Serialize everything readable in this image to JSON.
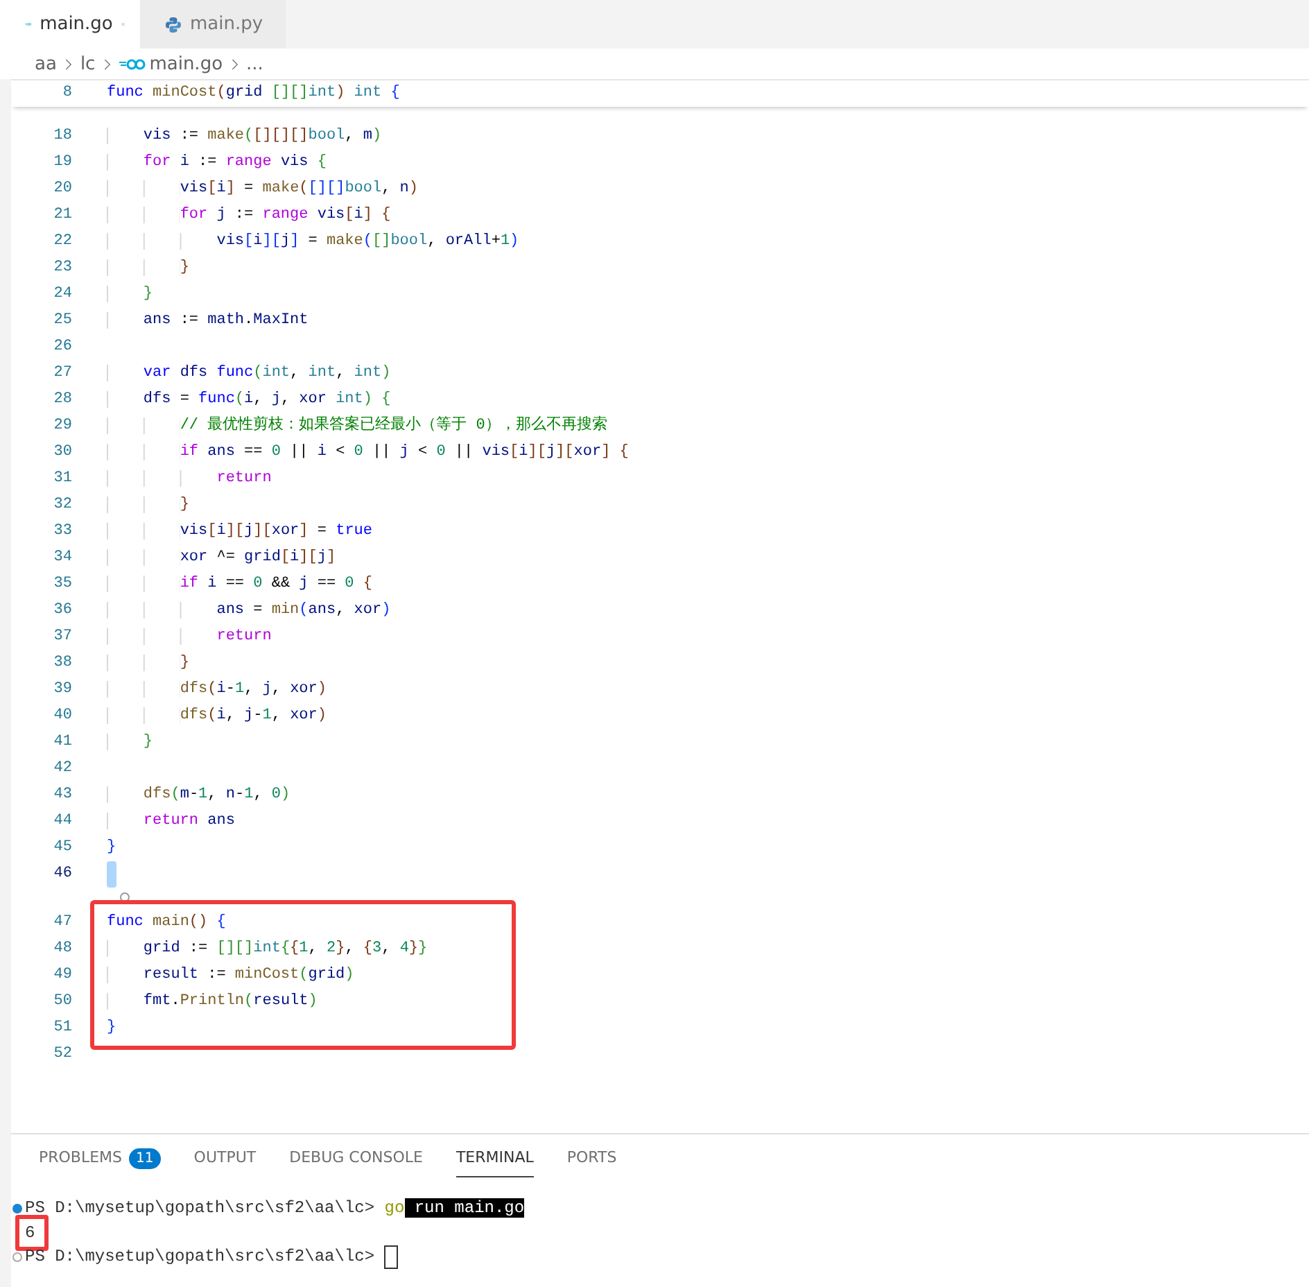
{
  "tabs": [
    {
      "label": "main.go",
      "kind": "go",
      "selected": true
    },
    {
      "label": "main.py",
      "kind": "python",
      "selected": false
    }
  ],
  "breadcrumb": [
    {
      "label": "aa"
    },
    {
      "label": "lc"
    },
    {
      "label": "main.go",
      "kind": "go"
    },
    {
      "label": "..."
    }
  ],
  "sticky_line": {
    "n": "8",
    "tokens": [
      {
        "kind": "kw",
        "text": "func "
      },
      {
        "kind": "fn",
        "text": "minCost"
      },
      {
        "kind": "b3",
        "text": "("
      },
      {
        "kind": "var",
        "text": "grid "
      },
      {
        "kind": "b2",
        "text": "[][]"
      },
      {
        "kind": "type",
        "text": "int"
      },
      {
        "kind": "b3",
        "text": ") "
      },
      {
        "kind": "type",
        "text": "int "
      },
      {
        "kind": "b1",
        "text": "{"
      }
    ]
  },
  "blocks": [
    {
      "framed": false,
      "lines": [
        {
          "n": "18",
          "tokens": [
            {
              "kind": "var",
              "text": "    vis"
            },
            {
              "kind": "op",
              "text": " := "
            },
            {
              "kind": "fn",
              "text": "make"
            },
            {
              "kind": "b2",
              "text": "("
            },
            {
              "kind": "b3",
              "text": "[][][]"
            },
            {
              "kind": "type",
              "text": "bool"
            },
            {
              "kind": "op",
              "text": ", "
            },
            {
              "kind": "var",
              "text": "m"
            },
            {
              "kind": "b2",
              "text": ")"
            }
          ]
        },
        {
          "n": "19",
          "tokens": [
            {
              "kind": "ctl",
              "text": "    for "
            },
            {
              "kind": "var",
              "text": "i"
            },
            {
              "kind": "op",
              "text": " := "
            },
            {
              "kind": "ctl",
              "text": "range "
            },
            {
              "kind": "var",
              "text": "vis "
            },
            {
              "kind": "b2",
              "text": "{"
            }
          ]
        },
        {
          "n": "20",
          "tokens": [
            {
              "kind": "var",
              "text": "        vis"
            },
            {
              "kind": "b3",
              "text": "["
            },
            {
              "kind": "var",
              "text": "i"
            },
            {
              "kind": "b3",
              "text": "]"
            },
            {
              "kind": "op",
              "text": " = "
            },
            {
              "kind": "fn",
              "text": "make"
            },
            {
              "kind": "b3",
              "text": "("
            },
            {
              "kind": "b1",
              "text": "[][]"
            },
            {
              "kind": "type",
              "text": "bool"
            },
            {
              "kind": "op",
              "text": ", "
            },
            {
              "kind": "var",
              "text": "n"
            },
            {
              "kind": "b3",
              "text": ")"
            }
          ]
        },
        {
          "n": "21",
          "tokens": [
            {
              "kind": "ctl",
              "text": "        for "
            },
            {
              "kind": "var",
              "text": "j"
            },
            {
              "kind": "op",
              "text": " := "
            },
            {
              "kind": "ctl",
              "text": "range "
            },
            {
              "kind": "var",
              "text": "vis"
            },
            {
              "kind": "b3",
              "text": "["
            },
            {
              "kind": "var",
              "text": "i"
            },
            {
              "kind": "b3",
              "text": "] {"
            }
          ]
        },
        {
          "n": "22",
          "tokens": [
            {
              "kind": "var",
              "text": "            vis"
            },
            {
              "kind": "b1",
              "text": "["
            },
            {
              "kind": "var",
              "text": "i"
            },
            {
              "kind": "b1",
              "text": "]["
            },
            {
              "kind": "var",
              "text": "j"
            },
            {
              "kind": "b1",
              "text": "]"
            },
            {
              "kind": "op",
              "text": " = "
            },
            {
              "kind": "fn",
              "text": "make"
            },
            {
              "kind": "b1",
              "text": "("
            },
            {
              "kind": "b2",
              "text": "[]"
            },
            {
              "kind": "type",
              "text": "bool"
            },
            {
              "kind": "op",
              "text": ", "
            },
            {
              "kind": "var",
              "text": "orAll"
            },
            {
              "kind": "op",
              "text": "+"
            },
            {
              "kind": "num",
              "text": "1"
            },
            {
              "kind": "b1",
              "text": ")"
            }
          ]
        },
        {
          "n": "23",
          "tokens": [
            {
              "kind": "b3",
              "text": "        }"
            }
          ]
        },
        {
          "n": "24",
          "tokens": [
            {
              "kind": "b2",
              "text": "    }"
            }
          ]
        },
        {
          "n": "25",
          "tokens": [
            {
              "kind": "var",
              "text": "    ans"
            },
            {
              "kind": "op",
              "text": " := "
            },
            {
              "kind": "var",
              "text": "math"
            },
            {
              "kind": "op",
              "text": "."
            },
            {
              "kind": "var",
              "text": "MaxInt"
            }
          ]
        },
        {
          "n": "26"
        },
        {
          "n": "27",
          "tokens": [
            {
              "kind": "kw",
              "text": "    var "
            },
            {
              "kind": "var",
              "text": "dfs "
            },
            {
              "kind": "kw",
              "text": "func"
            },
            {
              "kind": "b2",
              "text": "("
            },
            {
              "kind": "type",
              "text": "int"
            },
            {
              "kind": "op",
              "text": ", "
            },
            {
              "kind": "type",
              "text": "int"
            },
            {
              "kind": "op",
              "text": ", "
            },
            {
              "kind": "type",
              "text": "int"
            },
            {
              "kind": "b2",
              "text": ")"
            }
          ]
        },
        {
          "n": "28",
          "tokens": [
            {
              "kind": "var",
              "text": "    dfs"
            },
            {
              "kind": "op",
              "text": " = "
            },
            {
              "kind": "kw",
              "text": "func"
            },
            {
              "kind": "b2",
              "text": "("
            },
            {
              "kind": "var",
              "text": "i"
            },
            {
              "kind": "op",
              "text": ", "
            },
            {
              "kind": "var",
              "text": "j"
            },
            {
              "kind": "op",
              "text": ", "
            },
            {
              "kind": "var",
              "text": "xor "
            },
            {
              "kind": "type",
              "text": "int"
            },
            {
              "kind": "b2",
              "text": ") {"
            }
          ]
        },
        {
          "n": "29",
          "tokens": [
            {
              "kind": "com",
              "text": "        // 最优性剪枝：如果答案已经最小（等于 0），那么不再搜索"
            }
          ]
        },
        {
          "n": "30",
          "tokens": [
            {
              "kind": "ctl",
              "text": "        if "
            },
            {
              "kind": "var",
              "text": "ans"
            },
            {
              "kind": "op",
              "text": " == "
            },
            {
              "kind": "num",
              "text": "0"
            },
            {
              "kind": "op",
              "text": " || "
            },
            {
              "kind": "var",
              "text": "i"
            },
            {
              "kind": "op",
              "text": " < "
            },
            {
              "kind": "num",
              "text": "0"
            },
            {
              "kind": "op",
              "text": " || "
            },
            {
              "kind": "var",
              "text": "j"
            },
            {
              "kind": "op",
              "text": " < "
            },
            {
              "kind": "num",
              "text": "0"
            },
            {
              "kind": "op",
              "text": " || "
            },
            {
              "kind": "var",
              "text": "vis"
            },
            {
              "kind": "b3",
              "text": "["
            },
            {
              "kind": "var",
              "text": "i"
            },
            {
              "kind": "b3",
              "text": "]["
            },
            {
              "kind": "var",
              "text": "j"
            },
            {
              "kind": "b3",
              "text": "]["
            },
            {
              "kind": "var",
              "text": "xor"
            },
            {
              "kind": "b3",
              "text": "] {"
            }
          ]
        },
        {
          "n": "31",
          "tokens": [
            {
              "kind": "ctl",
              "text": "            return"
            }
          ]
        },
        {
          "n": "32",
          "tokens": [
            {
              "kind": "b3",
              "text": "        }"
            }
          ]
        },
        {
          "n": "33",
          "tokens": [
            {
              "kind": "var",
              "text": "        vis"
            },
            {
              "kind": "b3",
              "text": "["
            },
            {
              "kind": "var",
              "text": "i"
            },
            {
              "kind": "b3",
              "text": "]["
            },
            {
              "kind": "var",
              "text": "j"
            },
            {
              "kind": "b3",
              "text": "]["
            },
            {
              "kind": "var",
              "text": "xor"
            },
            {
              "kind": "b3",
              "text": "]"
            },
            {
              "kind": "op",
              "text": " = "
            },
            {
              "kind": "kw",
              "text": "true"
            }
          ]
        },
        {
          "n": "34",
          "tokens": [
            {
              "kind": "var",
              "text": "        xor"
            },
            {
              "kind": "op",
              "text": " ^= "
            },
            {
              "kind": "var",
              "text": "grid"
            },
            {
              "kind": "b3",
              "text": "["
            },
            {
              "kind": "var",
              "text": "i"
            },
            {
              "kind": "b3",
              "text": "]["
            },
            {
              "kind": "var",
              "text": "j"
            },
            {
              "kind": "b3",
              "text": "]"
            }
          ]
        },
        {
          "n": "35",
          "tokens": [
            {
              "kind": "ctl",
              "text": "        if "
            },
            {
              "kind": "var",
              "text": "i"
            },
            {
              "kind": "op",
              "text": " == "
            },
            {
              "kind": "num",
              "text": "0"
            },
            {
              "kind": "op",
              "text": " && "
            },
            {
              "kind": "var",
              "text": "j"
            },
            {
              "kind": "op",
              "text": " == "
            },
            {
              "kind": "num",
              "text": "0"
            },
            {
              "kind": "b3",
              "text": " {"
            }
          ]
        },
        {
          "n": "36",
          "tokens": [
            {
              "kind": "var",
              "text": "            ans"
            },
            {
              "kind": "op",
              "text": " = "
            },
            {
              "kind": "fn",
              "text": "min"
            },
            {
              "kind": "b1",
              "text": "("
            },
            {
              "kind": "var",
              "text": "ans"
            },
            {
              "kind": "op",
              "text": ", "
            },
            {
              "kind": "var",
              "text": "xor"
            },
            {
              "kind": "b1",
              "text": ")"
            }
          ]
        },
        {
          "n": "37",
          "tokens": [
            {
              "kind": "ctl",
              "text": "            return"
            }
          ]
        },
        {
          "n": "38",
          "tokens": [
            {
              "kind": "b3",
              "text": "        }"
            }
          ]
        },
        {
          "n": "39",
          "tokens": [
            {
              "kind": "fn",
              "text": "        dfs"
            },
            {
              "kind": "b3",
              "text": "("
            },
            {
              "kind": "var",
              "text": "i"
            },
            {
              "kind": "op",
              "text": "-"
            },
            {
              "kind": "num",
              "text": "1"
            },
            {
              "kind": "op",
              "text": ", "
            },
            {
              "kind": "var",
              "text": "j"
            },
            {
              "kind": "op",
              "text": ", "
            },
            {
              "kind": "var",
              "text": "xor"
            },
            {
              "kind": "b3",
              "text": ")"
            }
          ]
        },
        {
          "n": "40",
          "tokens": [
            {
              "kind": "fn",
              "text": "        dfs"
            },
            {
              "kind": "b3",
              "text": "("
            },
            {
              "kind": "var",
              "text": "i"
            },
            {
              "kind": "op",
              "text": ", "
            },
            {
              "kind": "var",
              "text": "j"
            },
            {
              "kind": "op",
              "text": "-"
            },
            {
              "kind": "num",
              "text": "1"
            },
            {
              "kind": "op",
              "text": ", "
            },
            {
              "kind": "var",
              "text": "xor"
            },
            {
              "kind": "b3",
              "text": ")"
            }
          ]
        },
        {
          "n": "41",
          "tokens": [
            {
              "kind": "b2",
              "text": "    }"
            }
          ]
        },
        {
          "n": "42"
        },
        {
          "n": "43",
          "tokens": [
            {
              "kind": "fn",
              "text": "    dfs"
            },
            {
              "kind": "b2",
              "text": "("
            },
            {
              "kind": "var",
              "text": "m"
            },
            {
              "kind": "op",
              "text": "-"
            },
            {
              "kind": "num",
              "text": "1"
            },
            {
              "kind": "op",
              "text": ", "
            },
            {
              "kind": "var",
              "text": "n"
            },
            {
              "kind": "op",
              "text": "-"
            },
            {
              "kind": "num",
              "text": "1"
            },
            {
              "kind": "op",
              "text": ", "
            },
            {
              "kind": "num",
              "text": "0"
            },
            {
              "kind": "b2",
              "text": ")"
            }
          ]
        },
        {
          "n": "44",
          "tokens": [
            {
              "kind": "ctl",
              "text": "    return "
            },
            {
              "kind": "var",
              "text": "ans"
            }
          ]
        },
        {
          "n": "45",
          "tokens": [
            {
              "kind": "b1",
              "text": "}"
            }
          ]
        },
        {
          "n": "46",
          "current": true
        }
      ]
    },
    {
      "framed": true,
      "codelens": true,
      "lines": [
        {
          "n": "47",
          "tokens": [
            {
              "kind": "kw",
              "text": "func "
            },
            {
              "kind": "fn",
              "text": "main"
            },
            {
              "kind": "b3",
              "text": "() "
            },
            {
              "kind": "b1",
              "text": "{"
            }
          ]
        },
        {
          "n": "48",
          "tokens": [
            {
              "kind": "var",
              "text": "    grid"
            },
            {
              "kind": "op",
              "text": " := "
            },
            {
              "kind": "b2",
              "text": "[][]"
            },
            {
              "kind": "type",
              "text": "int"
            },
            {
              "kind": "b2",
              "text": "{"
            },
            {
              "kind": "b3",
              "text": "{"
            },
            {
              "kind": "num",
              "text": "1"
            },
            {
              "kind": "op",
              "text": ", "
            },
            {
              "kind": "num",
              "text": "2"
            },
            {
              "kind": "b3",
              "text": "}"
            },
            {
              "kind": "op",
              "text": ", "
            },
            {
              "kind": "b3",
              "text": "{"
            },
            {
              "kind": "num",
              "text": "3"
            },
            {
              "kind": "op",
              "text": ", "
            },
            {
              "kind": "num",
              "text": "4"
            },
            {
              "kind": "b3",
              "text": "}"
            },
            {
              "kind": "b2",
              "text": "}"
            }
          ]
        },
        {
          "n": "49",
          "tokens": [
            {
              "kind": "var",
              "text": "    result"
            },
            {
              "kind": "op",
              "text": " := "
            },
            {
              "kind": "fn",
              "text": "minCost"
            },
            {
              "kind": "b2",
              "text": "("
            },
            {
              "kind": "var",
              "text": "grid"
            },
            {
              "kind": "b2",
              "text": ")"
            }
          ]
        },
        {
          "n": "50",
          "tokens": [
            {
              "kind": "var",
              "text": "    fmt"
            },
            {
              "kind": "op",
              "text": "."
            },
            {
              "kind": "fn",
              "text": "Println"
            },
            {
              "kind": "b2",
              "text": "("
            },
            {
              "kind": "var",
              "text": "result"
            },
            {
              "kind": "b2",
              "text": ")"
            }
          ]
        },
        {
          "n": "51",
          "tokens": [
            {
              "kind": "b1",
              "text": "}"
            }
          ]
        }
      ]
    },
    {
      "framed": false,
      "lines": [
        {
          "n": "52"
        }
      ]
    }
  ],
  "panel_tabs": [
    {
      "label": "PROBLEMS",
      "badge": "11",
      "selected": false
    },
    {
      "label": "OUTPUT",
      "selected": false
    },
    {
      "label": "DEBUG CONSOLE",
      "selected": false
    },
    {
      "label": "TERMINAL",
      "selected": true
    },
    {
      "label": "PORTS",
      "selected": false
    }
  ],
  "terminal": [
    {
      "kind": "filled",
      "segments": [
        {
          "kind": "plain",
          "text": "PS D:\\mysetup\\gopath\\src\\sf2\\aa\\lc> "
        },
        {
          "kind": "cmd",
          "text": "go"
        },
        {
          "kind": "sel",
          "text": " run main.go"
        }
      ]
    },
    {
      "framed": true,
      "segments": [
        {
          "kind": "plain",
          "text": "6"
        }
      ]
    },
    {
      "kind": "hollow",
      "cursor": true,
      "segments": [
        {
          "kind": "plain",
          "text": "PS D:\\mysetup\\gopath\\src\\sf2\\aa\\lc> "
        }
      ]
    }
  ]
}
